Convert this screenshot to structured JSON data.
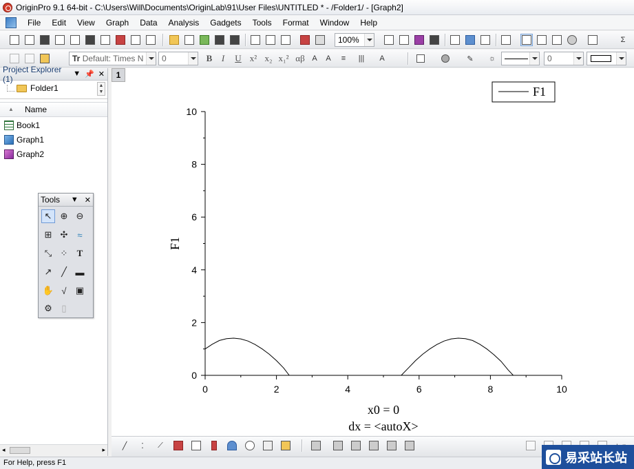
{
  "window": {
    "title": "OriginPro 9.1 64-bit - C:\\Users\\Will\\Documents\\OriginLab\\91\\User Files\\UNTITLED * - /Folder1/ - [Graph2]"
  },
  "menu": {
    "items": [
      "File",
      "Edit",
      "View",
      "Graph",
      "Data",
      "Analysis",
      "Gadgets",
      "Tools",
      "Format",
      "Window",
      "Help"
    ]
  },
  "toolbar": {
    "zoom": "100%",
    "font": "Default: Times N",
    "font_size": "0",
    "line_width": "0",
    "bold": "B",
    "italic": "I",
    "underline": "U",
    "superscript": "x²",
    "subscript": "x₂",
    "supsub": "x₁²",
    "greek": "αβ",
    "sigma": "Σ"
  },
  "explorer": {
    "title": "Project Explorer (1)",
    "folder": "Folder1",
    "column_header": "Name",
    "items": [
      {
        "label": "Book1",
        "icon": "workbook-icon"
      },
      {
        "label": "Graph1",
        "icon": "graph-icon"
      },
      {
        "label": "Graph2",
        "icon": "graph-icon"
      }
    ]
  },
  "tools_palette": {
    "title": "Tools",
    "text_tool": "T"
  },
  "graph": {
    "layer_number": "1",
    "legend": "F1",
    "xlabel_line1": "x0 = 0",
    "xlabel_line2": "dx = <autoX>"
  },
  "chart_data": {
    "type": "line",
    "series": [
      {
        "name": "F1",
        "x": [
          0,
          0.2,
          0.4,
          0.6,
          0.8,
          1.0,
          1.2,
          1.4,
          1.6,
          1.8,
          2.0,
          2.2,
          2.36,
          2.5,
          3.0,
          3.5,
          4.0,
          4.5,
          5.0,
          5.5,
          5.7,
          5.9,
          6.1,
          6.3,
          6.5,
          6.7,
          6.9,
          7.1,
          7.3,
          7.5,
          7.7,
          7.9,
          8.1,
          8.3,
          8.5,
          8.64,
          9.0,
          9.5,
          10.0
        ],
        "y": [
          1.0,
          1.18,
          1.32,
          1.39,
          1.41,
          1.38,
          1.3,
          1.17,
          1.0,
          0.8,
          0.56,
          0.28,
          0.0,
          0.0,
          0.0,
          0.0,
          0.0,
          0.0,
          0.0,
          0.0,
          0.28,
          0.56,
          0.8,
          1.0,
          1.17,
          1.3,
          1.38,
          1.41,
          1.39,
          1.32,
          1.18,
          1.0,
          0.78,
          0.53,
          0.2,
          0.0,
          0.0,
          0.0,
          0.0
        ]
      }
    ],
    "xlim": [
      0,
      10
    ],
    "ylim": [
      0,
      10
    ],
    "xticks": [
      "0",
      "2",
      "4",
      "6",
      "8",
      "10"
    ],
    "yticks": [
      "0",
      "2",
      "4",
      "6",
      "8",
      "10"
    ],
    "xlabel": "x0 = 0\ndx = <autoX>",
    "ylabel": "F1",
    "grid": false,
    "legend": "top-right"
  },
  "statusbar": {
    "text": "For Help, press F1"
  },
  "watermark": {
    "text": "易采站长站"
  }
}
